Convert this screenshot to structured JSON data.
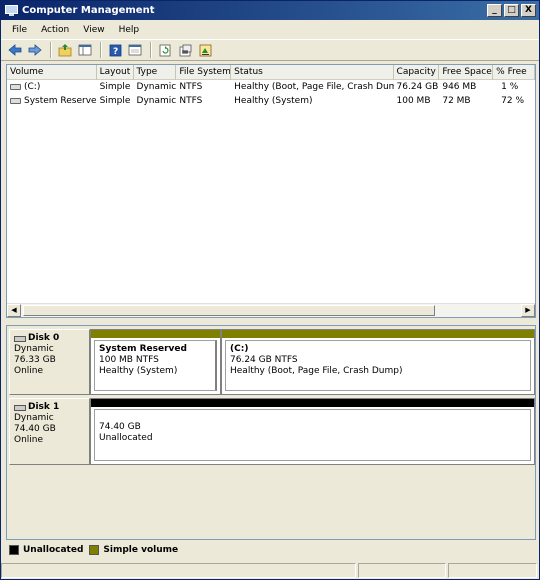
{
  "window": {
    "title": "Computer Management",
    "controls": [
      "_",
      "□",
      "X"
    ]
  },
  "menu": [
    "File",
    "Action",
    "View",
    "Help"
  ],
  "toolbar": {
    "icons": [
      "back-icon",
      "forward-icon",
      "up-folder-icon",
      "show-hide-tree-icon",
      "help-icon",
      "console-icon",
      "refresh-icon",
      "properties-icon",
      "export-icon"
    ]
  },
  "volume_list": {
    "columns": [
      "Volume",
      "Layout",
      "Type",
      "File System",
      "Status",
      "Capacity",
      "Free Space",
      "% Free"
    ],
    "rows": [
      {
        "volume": "(C:)",
        "layout": "Simple",
        "type": "Dynamic",
        "fs": "NTFS",
        "status": "Healthy (Boot, Page File, Crash Dump)",
        "capacity": "76.24 GB",
        "free": "946 MB",
        "pct": "1 %"
      },
      {
        "volume": "System Reserved",
        "layout": "Simple",
        "type": "Dynamic",
        "fs": "NTFS",
        "status": "Healthy (System)",
        "capacity": "100 MB",
        "free": "72 MB",
        "pct": "72 %"
      }
    ]
  },
  "disks": [
    {
      "name": "Disk 0",
      "type": "Dynamic",
      "size": "76.33 GB",
      "state": "Online",
      "partitions": [
        {
          "name": "System Reserved",
          "detail": "100 MB NTFS",
          "status": "Healthy (System)",
          "kind": "simple"
        },
        {
          "name": "(C:)",
          "detail": "76.24 GB NTFS",
          "status": "Healthy (Boot, Page File, Crash Dump)",
          "kind": "simple"
        }
      ]
    },
    {
      "name": "Disk 1",
      "type": "Dynamic",
      "size": "74.40 GB",
      "state": "Online",
      "partitions": [
        {
          "name": "",
          "detail": "74.40 GB",
          "status": "Unallocated",
          "kind": "unallocated"
        }
      ]
    }
  ],
  "legend": [
    {
      "label": "Unallocated",
      "color": "#000000"
    },
    {
      "label": "Simple volume",
      "color": "#808000"
    }
  ],
  "colors": {
    "simple": "#808000",
    "unallocated": "#000000"
  }
}
